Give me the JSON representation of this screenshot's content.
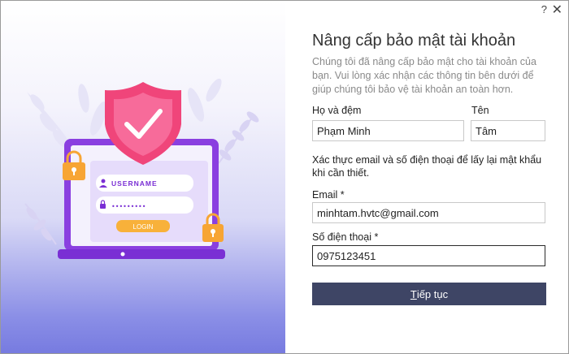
{
  "window": {
    "help_label": "?",
    "close_label": "✕"
  },
  "illustration": {
    "username_label": "USERNAME",
    "password_mask": "•••••••••",
    "login_label": "LOGIN"
  },
  "form": {
    "title": "Nâng cấp bảo mật tài khoản",
    "subtitle": "Chúng tôi đã nâng cấp bảo mật cho tài khoản của bạn. Vui lòng xác nhận các thông tin bên dưới để giúp chúng tôi bảo vệ tài khoản an toàn hơn.",
    "first_name_label": "Họ và đệm",
    "first_name_value": "Phạm Minh",
    "last_name_label": "Tên",
    "last_name_value": "Tâm",
    "verify_note": "Xác thực email và số điện thoại để lấy lại mật khẩu khi cần thiết.",
    "email_label": "Email *",
    "email_value": "minhtam.hvtc@gmail.com",
    "phone_label": "Số điện thoại *",
    "phone_value": "0975123451",
    "continue_mnemonic": "T",
    "continue_rest": "iếp tục"
  },
  "colors": {
    "shield": "#f0457a",
    "laptop": "#8a3fe0",
    "lock": "#f7a534",
    "button": "#3e4565",
    "login_button": "#f8b13a"
  }
}
